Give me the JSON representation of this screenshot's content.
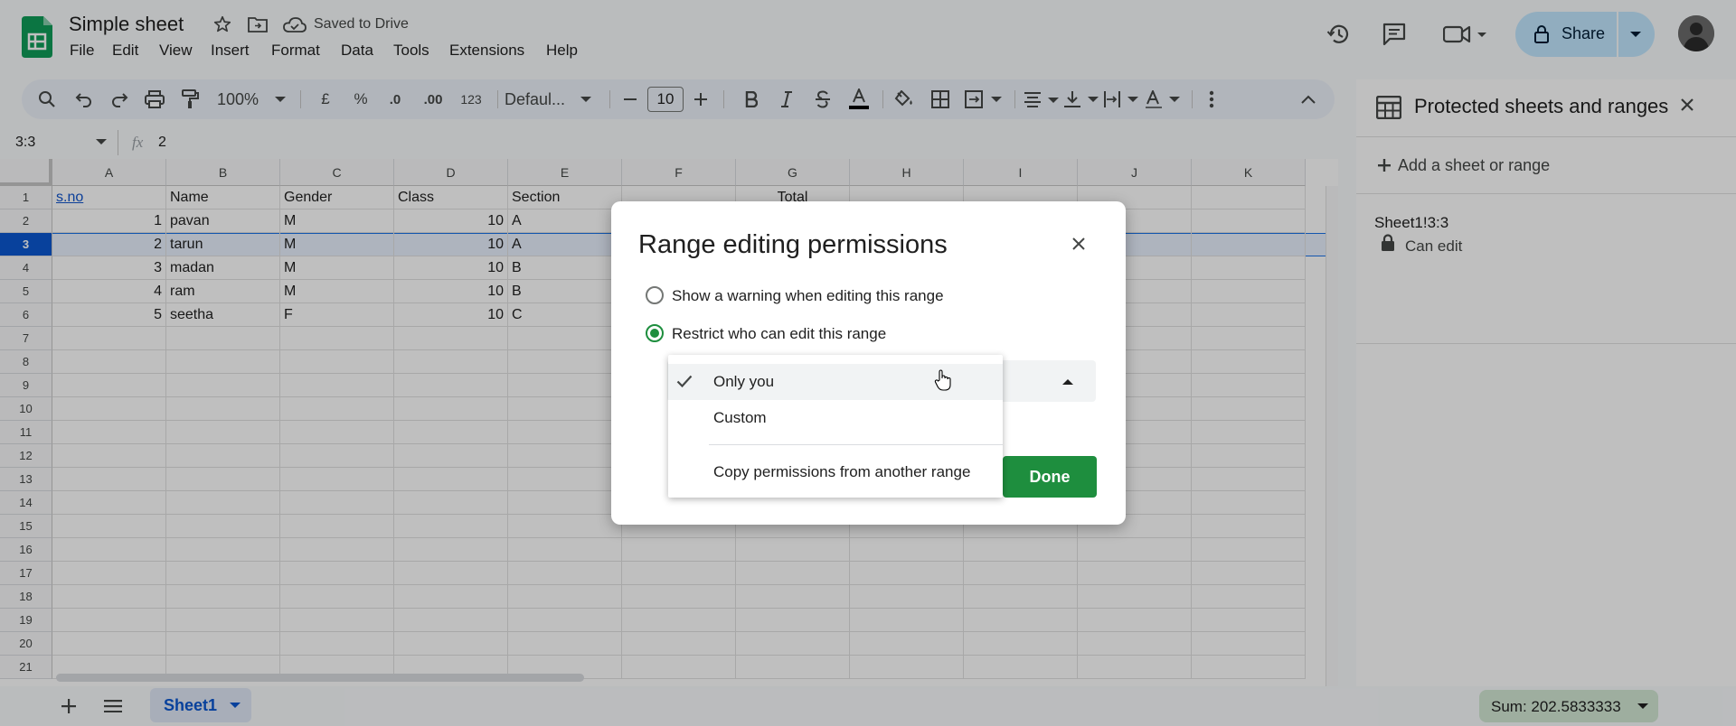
{
  "app": {
    "title": "Simple sheet",
    "saved_status": "Saved to Drive",
    "menu": [
      "File",
      "Edit",
      "View",
      "Insert",
      "Format",
      "Data",
      "Tools",
      "Extensions",
      "Help"
    ],
    "share_label": "Share"
  },
  "toolbar": {
    "zoom": "100%",
    "currency": "£",
    "percent": "%",
    "dec_decrease": ".0",
    "dec_increase": ".00",
    "number_format": "123",
    "font": "Defaul...",
    "font_size": "10"
  },
  "formula_bar": {
    "name_box": "3:3",
    "fx": "fx",
    "value": "2"
  },
  "grid": {
    "columns": [
      "A",
      "B",
      "C",
      "D",
      "E",
      "F",
      "G",
      "H",
      "I",
      "J",
      "K"
    ],
    "rows": [
      "1",
      "2",
      "3",
      "4",
      "5",
      "6",
      "7",
      "8",
      "9",
      "10",
      "11",
      "12",
      "13",
      "14",
      "15",
      "16",
      "17",
      "18",
      "19",
      "20",
      "21"
    ],
    "header_row": [
      "s.no",
      "Name",
      "Gender",
      "Class",
      "Section"
    ],
    "g1": "Total",
    "data": [
      [
        "1",
        "pavan",
        "M",
        "10",
        "A"
      ],
      [
        "2",
        "tarun",
        "M",
        "10",
        "A"
      ],
      [
        "3",
        "madan",
        "M",
        "10",
        "B"
      ],
      [
        "4",
        "ram",
        "M",
        "10",
        "B"
      ],
      [
        "5",
        "seetha",
        "F",
        "10",
        "C"
      ]
    ]
  },
  "panel": {
    "title": "Protected sheets and ranges",
    "add_label": "Add a sheet or range",
    "range_name": "Sheet1!3:3",
    "range_perm": "Can edit"
  },
  "dialog": {
    "title": "Range editing permissions",
    "option_warning": "Show a warning when editing this range",
    "option_restrict": "Restrict who can edit this range",
    "done_label": "Done",
    "dropdown": {
      "selected": "Only you",
      "options": [
        "Only you",
        "Custom",
        "Copy permissions from another range"
      ]
    }
  },
  "bottom": {
    "sheet_tab": "Sheet1",
    "sum": "Sum: 202.5833333"
  },
  "colors": {
    "accent_blue": "#0b57d0",
    "done_green": "#1e8e3e",
    "sheets_green": "#0f9d58",
    "selection_blue": "#e8f0fe"
  }
}
